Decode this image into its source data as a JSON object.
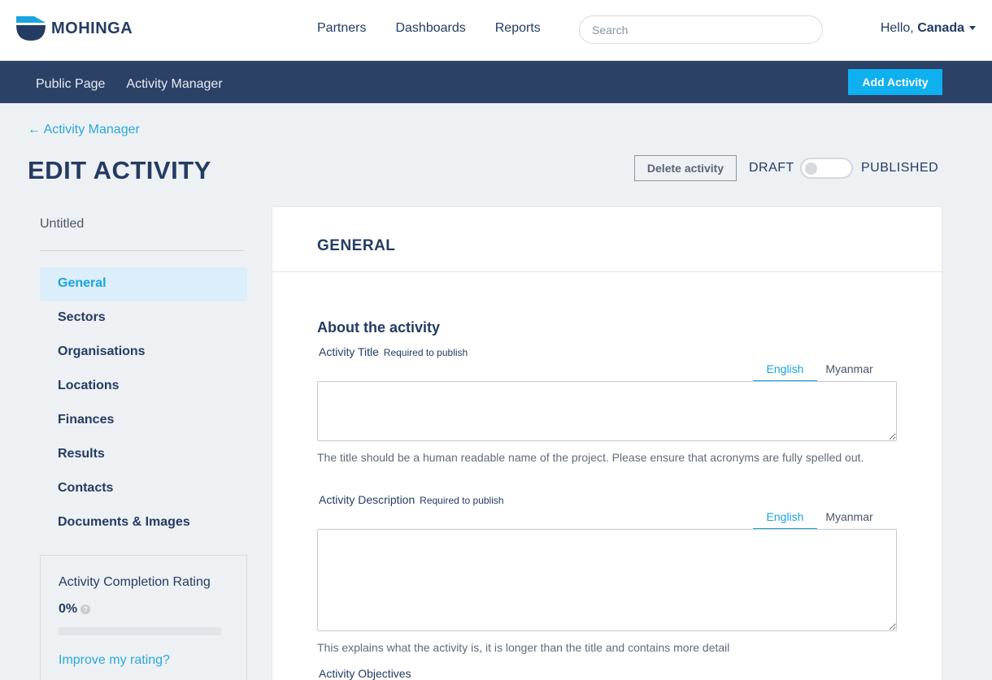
{
  "brand": {
    "name": "MOHINGA"
  },
  "topnav": {
    "items": [
      "Partners",
      "Dashboards",
      "Reports"
    ]
  },
  "search": {
    "placeholder": "Search",
    "value": ""
  },
  "user": {
    "greeting": "Hello,",
    "name": "Canada"
  },
  "subnav": {
    "items": [
      "Public Page",
      "Activity Manager"
    ],
    "add_label": "Add Activity"
  },
  "breadcrumb": {
    "back_label": "Activity Manager",
    "arrow": "←"
  },
  "page": {
    "title": "EDIT ACTIVITY",
    "delete_label": "Delete activity",
    "status_left": "DRAFT",
    "status_right": "PUBLISHED",
    "published": false
  },
  "sidebar": {
    "activity_name": "Untitled",
    "items": [
      {
        "label": "General",
        "active": true
      },
      {
        "label": "Sectors",
        "active": false
      },
      {
        "label": "Organisations",
        "active": false
      },
      {
        "label": "Locations",
        "active": false
      },
      {
        "label": "Finances",
        "active": false
      },
      {
        "label": "Results",
        "active": false
      },
      {
        "label": "Contacts",
        "active": false
      },
      {
        "label": "Documents & Images",
        "active": false
      }
    ],
    "rating": {
      "title": "Activity Completion Rating",
      "value": "0%",
      "progress": 0,
      "improve_label": "Improve my rating?"
    }
  },
  "panel": {
    "title": "GENERAL",
    "section_title": "About the activity",
    "fields": [
      {
        "label": "Activity Title",
        "required": "Required to publish",
        "tabs": [
          "English",
          "Myanmar"
        ],
        "value": "",
        "help": "The title should be a human readable name of the project. Please ensure that acronyms are fully spelled out."
      },
      {
        "label": "Activity Description",
        "required": "Required to publish",
        "tabs": [
          "English",
          "Myanmar"
        ],
        "value": "",
        "help": "This explains what the activity is, it is longer than the title and contains more detail"
      },
      {
        "label": "Activity Objectives"
      }
    ]
  },
  "colors": {
    "accent": "#1aa4df",
    "navy": "#243b63",
    "subbar": "#2c4166",
    "button": "#0fb0ef",
    "background": "#eef1f4"
  }
}
